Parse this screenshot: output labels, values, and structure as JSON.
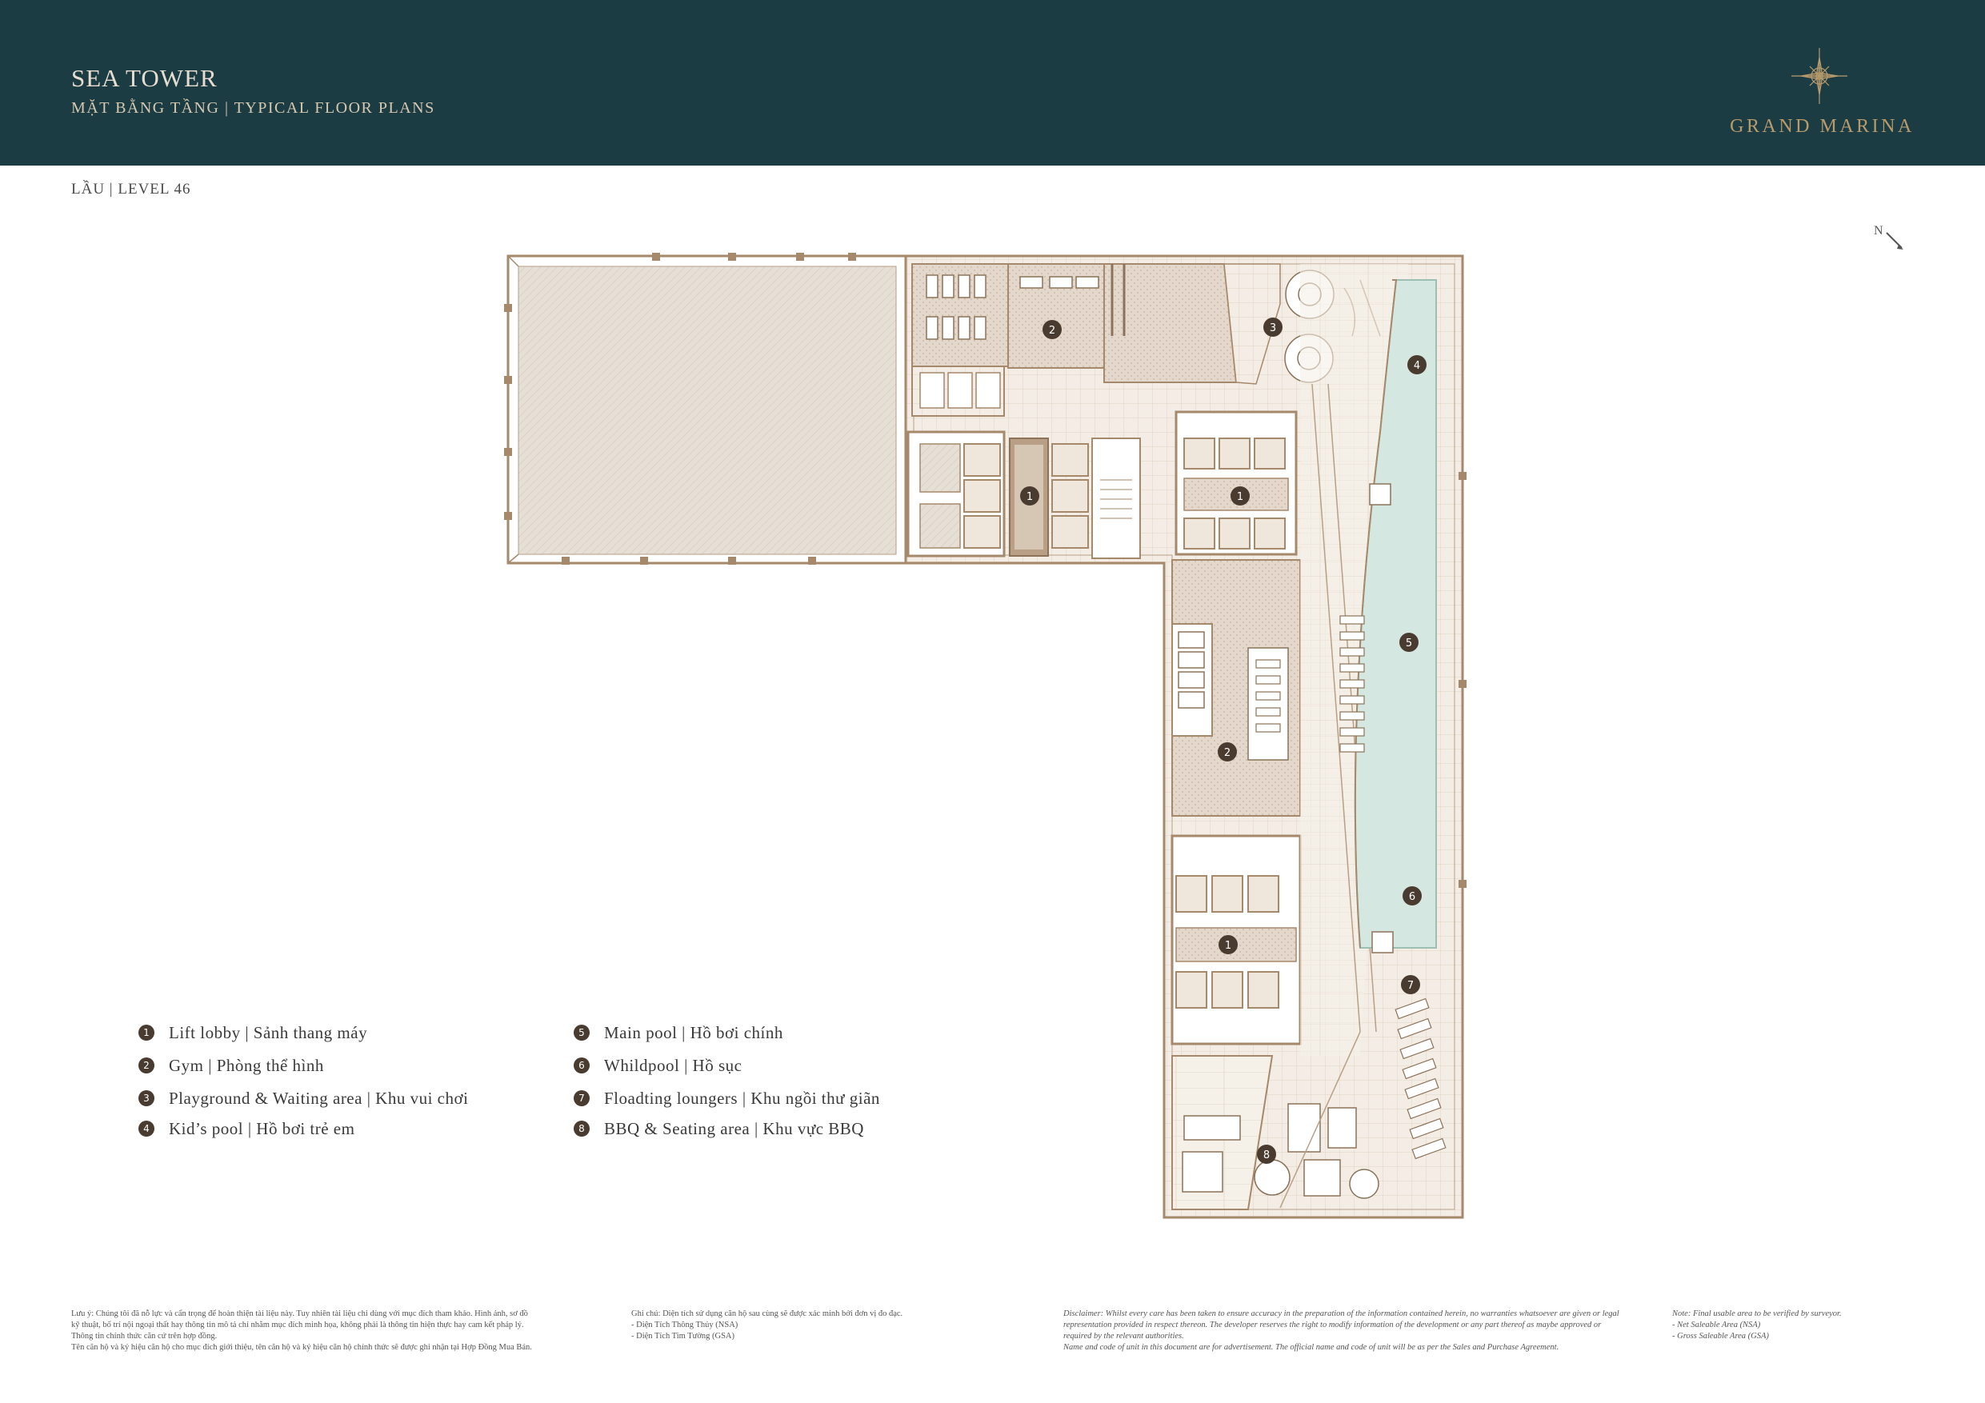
{
  "header": {
    "title": "SEA TOWER",
    "subtitle": "MẶT BẰNG TẦNG | TYPICAL FLOOR PLANS",
    "logo_text": "GRAND MARINA"
  },
  "level_label": "LẦU | LEVEL 46",
  "north_label": "N",
  "plan_markers": [
    {
      "num": "1"
    },
    {
      "num": "1"
    },
    {
      "num": "1"
    },
    {
      "num": "2"
    },
    {
      "num": "2"
    },
    {
      "num": "3"
    },
    {
      "num": "4"
    },
    {
      "num": "5"
    },
    {
      "num": "6"
    },
    {
      "num": "7"
    },
    {
      "num": "8"
    }
  ],
  "legend": {
    "left": [
      {
        "num": "1",
        "label": "Lift lobby | Sảnh thang máy"
      },
      {
        "num": "2",
        "label": "Gym | Phòng thể hình"
      },
      {
        "num": "3",
        "label": "Playground & Waiting area | Khu vui chơi"
      },
      {
        "num": "4",
        "label": "Kid’s pool | Hồ bơi trẻ em"
      }
    ],
    "right": [
      {
        "num": "5",
        "label": "Main pool | Hồ bơi chính"
      },
      {
        "num": "6",
        "label": "Whildpool | Hồ sục"
      },
      {
        "num": "7",
        "label": "Floadting loungers | Khu ngồi thư giãn"
      },
      {
        "num": "8",
        "label": "BBQ & Seating area | Khu vực BBQ"
      }
    ]
  },
  "footer": {
    "vn_note": [
      "Lưu ý: Chúng tôi đã nỗ lực và cẩn trọng để hoàn thiện tài liệu này. Tuy nhiên tài liệu chỉ dùng với mục đích tham khảo. Hình ảnh, sơ đồ",
      "kỹ thuật, bố trí nội ngoại thất hay thông tin mô tả chỉ nhằm mục đích minh họa, không phải là thông tin hiện thực hay cam kết pháp lý.",
      "Thông tin chính thức căn cứ trên hợp đồng.",
      "Tên căn hộ và ký hiệu căn hộ cho mục đích giới thiệu, tên căn hộ và ký hiệu căn hộ chính thức sẽ được ghi nhận tại Hợp Đồng Mua Bán."
    ],
    "vn_area": [
      "Ghi chú: Diện tích sử dụng căn hộ sau cùng sẽ được xác minh bởi đơn vị đo đạc.",
      "- Diện Tích Thông Thủy (NSA)",
      "- Diện Tích Tim Tường (GSA)"
    ],
    "en_disclaimer": [
      "Disclaimer: Whilst every care has been taken to ensure accuracy in the preparation of the information contained herein, no warranties whatsoever are given or legal",
      "representation provided in respect thereon. The developer reserves the right to modify information of the development or any part thereof as maybe approved or",
      "required by the relevant authorities.",
      "Name and code of unit in this document are for advertisement. The official name and code of unit will be as per the Sales and Purchase Agreement."
    ],
    "en_area": [
      "Note: Final usable area to be verified by surveyor.",
      "- Net Saleable Area (NSA)",
      "- Gross Saleable Area (GSA)"
    ]
  },
  "colors": {
    "header_bg": "#1c3c44",
    "wall": "#a6886a",
    "pool": "#d4e8e1",
    "marker": "#4a3b30",
    "gold": "#b89b6c"
  }
}
